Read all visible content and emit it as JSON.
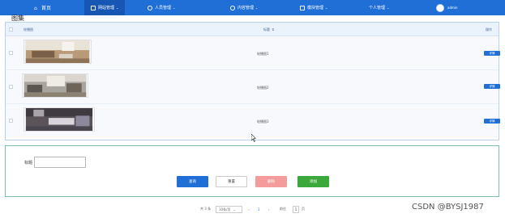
{
  "nav": {
    "items": [
      {
        "label": "首页"
      },
      {
        "label": "网站管理"
      },
      {
        "label": "人员管理"
      },
      {
        "label": "内容管理"
      },
      {
        "label": "模块管理"
      },
      {
        "label": "个人管理"
      }
    ],
    "user": "admin"
  },
  "page": {
    "title": "图集"
  },
  "table": {
    "headers": {
      "image": "轮播图",
      "title": "标题",
      "action": "操作"
    },
    "rows": [
      {
        "title": "轮播图1",
        "action": "详情"
      },
      {
        "title": "轮播图2",
        "action": "详情"
      },
      {
        "title": "轮播图3",
        "action": "详情"
      }
    ]
  },
  "search": {
    "label": "标题",
    "placeholder": "",
    "buttons": {
      "query": "查询",
      "reset": "重置",
      "delete": "删除",
      "add": "添加"
    }
  },
  "pager": {
    "total": "共 3 条",
    "page_size": "10条/页",
    "prev": "‹",
    "current": "1",
    "next": "›",
    "goto": "前往",
    "goto_page": "1",
    "unit": "页"
  },
  "watermark": "CSDN @BYSJ1987",
  "colors": {
    "primary": "#1f6fd6",
    "danger": "#f49c9c",
    "success": "#3aa83a"
  }
}
